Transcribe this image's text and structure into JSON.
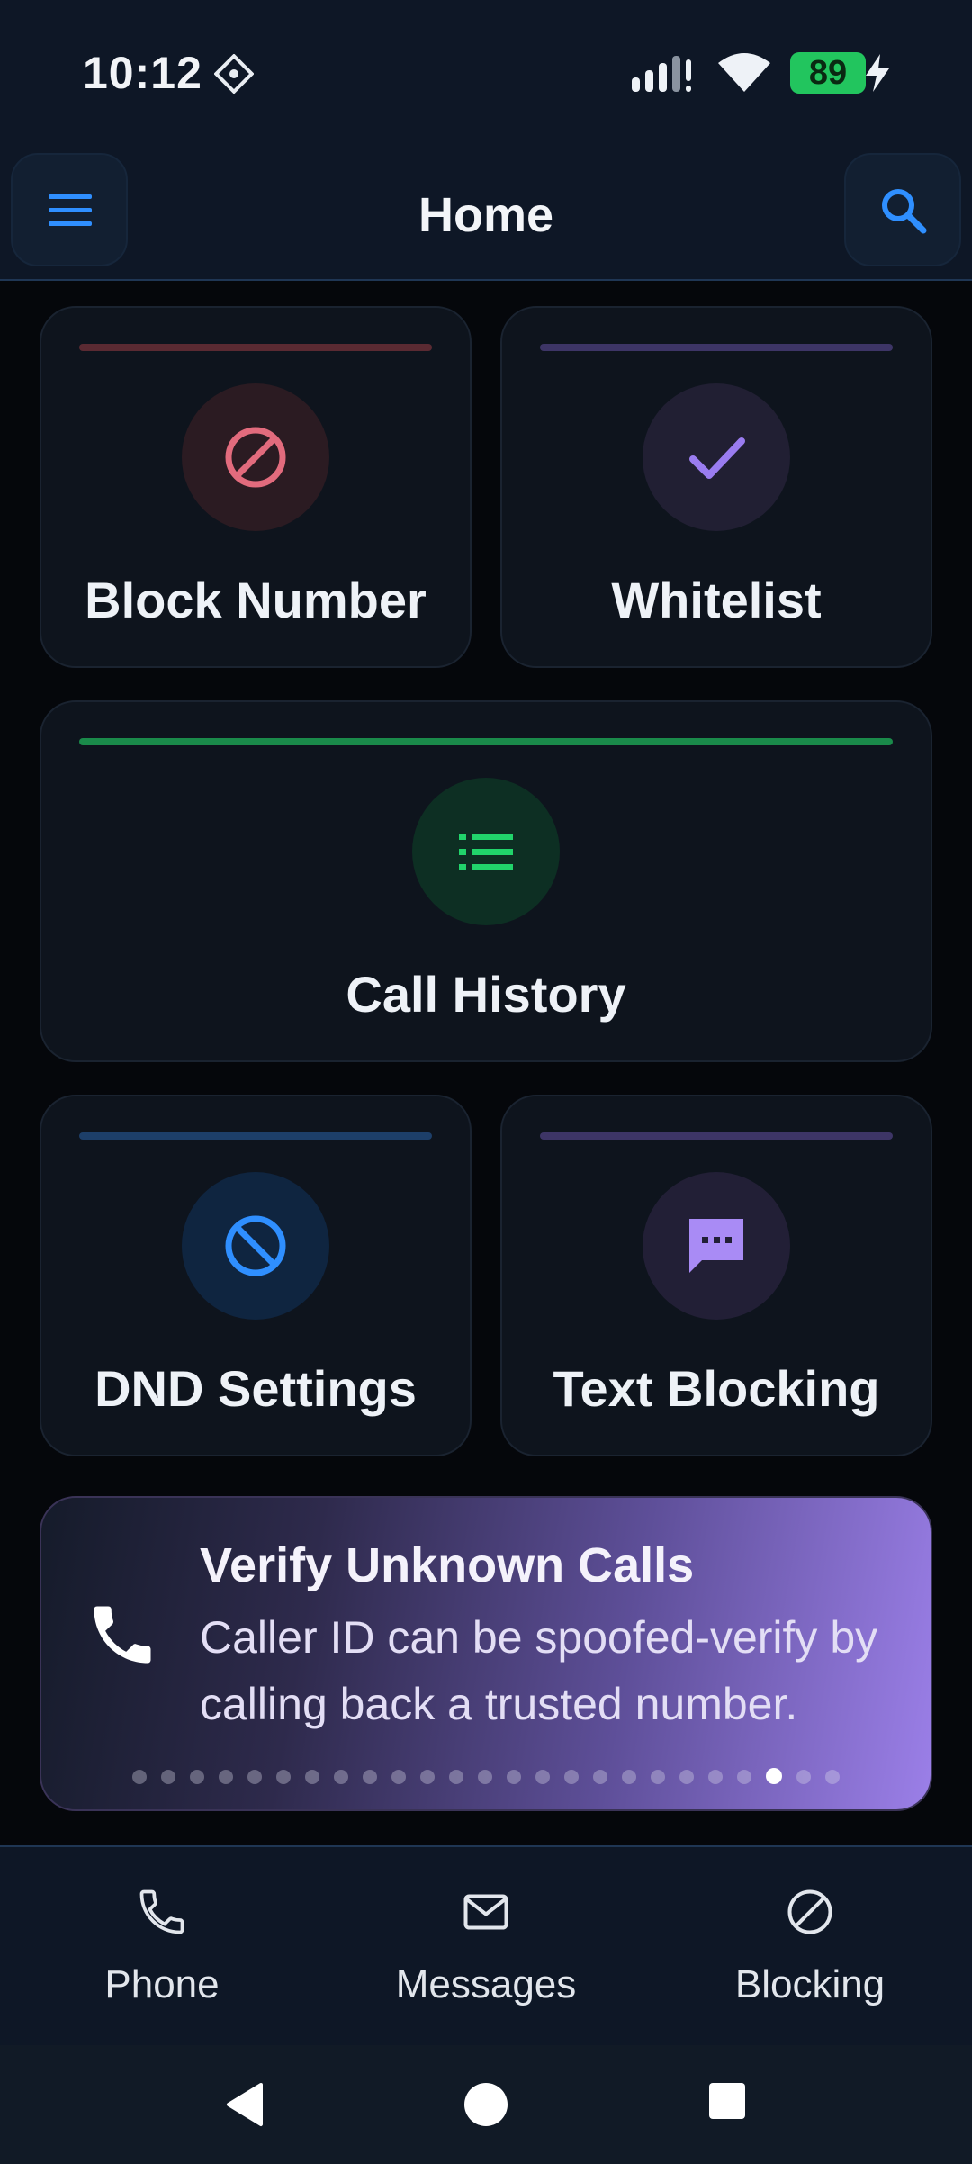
{
  "status_bar": {
    "time": "10:12",
    "battery": "89",
    "icons": [
      "app-notification-icon",
      "signal-icon",
      "wifi-icon",
      "battery-icon",
      "charging-icon"
    ]
  },
  "app_bar": {
    "title": "Home",
    "menu_icon": "menu-icon",
    "search_icon": "search-icon"
  },
  "cards": [
    {
      "label": "Block Number",
      "icon": "block-icon",
      "accent": "#e26b7d"
    },
    {
      "label": "Whitelist",
      "icon": "check-icon",
      "accent": "#9a7cf0"
    },
    {
      "label": "Call History",
      "icon": "list-icon",
      "accent": "#21d46b"
    },
    {
      "label": "DND Settings",
      "icon": "dnd-icon",
      "accent": "#2f8fff"
    },
    {
      "label": "Text Blocking",
      "icon": "message-icon",
      "accent": "#a98bf5"
    }
  ],
  "banner": {
    "title": "Verify Unknown Calls",
    "text": "Caller ID can be spoofed-verify by calling back a trusted number.",
    "icon": "phone-icon",
    "page_count": 25,
    "active_page": 22
  },
  "bottom_nav": [
    {
      "label": "Phone",
      "icon": "phone-icon"
    },
    {
      "label": "Messages",
      "icon": "mail-icon"
    },
    {
      "label": "Blocking",
      "icon": "block-icon"
    }
  ],
  "system_nav": [
    "back-icon",
    "home-icon",
    "recents-icon"
  ]
}
